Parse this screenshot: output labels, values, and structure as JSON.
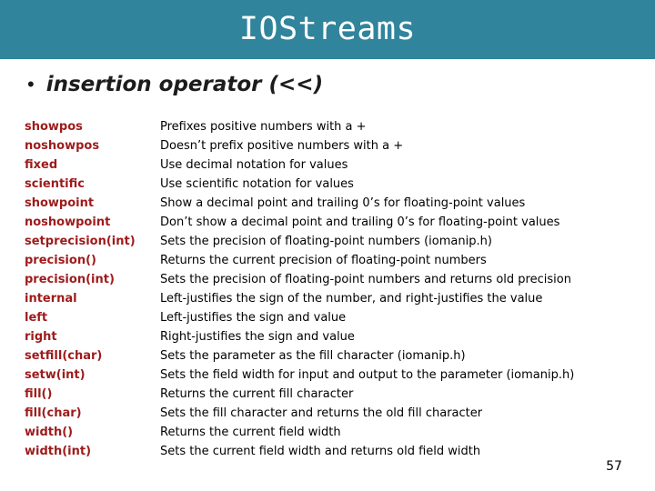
{
  "slide": {
    "title": "IOStreams",
    "page_number": "57",
    "banner_color": "#30849C",
    "term_color": "#9E1B1B",
    "background_color": "#FFFFFF"
  },
  "bullet": {
    "marker": "•",
    "text": "insertion operator (<<)"
  },
  "table": {
    "rows": [
      {
        "term": "showpos",
        "desc": "Prefixes positive numbers with a +"
      },
      {
        "term": "noshowpos",
        "desc": "Doesn’t prefix positive numbers with a +"
      },
      {
        "term": "fixed",
        "desc": "Use decimal notation for values"
      },
      {
        "term": "scientific",
        "desc": "Use scientific notation for values"
      },
      {
        "term": "showpoint",
        "desc": "Show a decimal point and trailing 0’s for floating-point values"
      },
      {
        "term": "noshowpoint",
        "desc": "Don’t show a decimal point and trailing 0’s for floating-point values"
      },
      {
        "term": "setprecision(int)",
        "desc": "Sets the precision of floating-point numbers (iomanip.h)"
      },
      {
        "term": "precision()",
        "desc": "Returns the current precision of floating-point numbers"
      },
      {
        "term": "precision(int)",
        "desc": "Sets the precision of floating-point numbers and returns old precision"
      },
      {
        "term": "internal",
        "desc": "Left-justifies the sign of the number, and right-justifies the value"
      },
      {
        "term": "left",
        "desc": "Left-justifies the sign and value"
      },
      {
        "term": "right",
        "desc": "Right-justifies the sign and value"
      },
      {
        "term": "setfill(char)",
        "desc": "Sets the parameter as the fill character (iomanip.h)"
      },
      {
        "term": "setw(int)",
        "desc": "Sets the field width for input and output to the parameter (iomanip.h)"
      },
      {
        "term": "fill()",
        "desc": "Returns the current fill character"
      },
      {
        "term": "fill(char)",
        "desc": "Sets the fill character and returns the old fill character"
      },
      {
        "term": "width()",
        "desc": "Returns the current field width"
      },
      {
        "term": "width(int)",
        "desc": "Sets the current field width and returns old field width"
      }
    ]
  }
}
